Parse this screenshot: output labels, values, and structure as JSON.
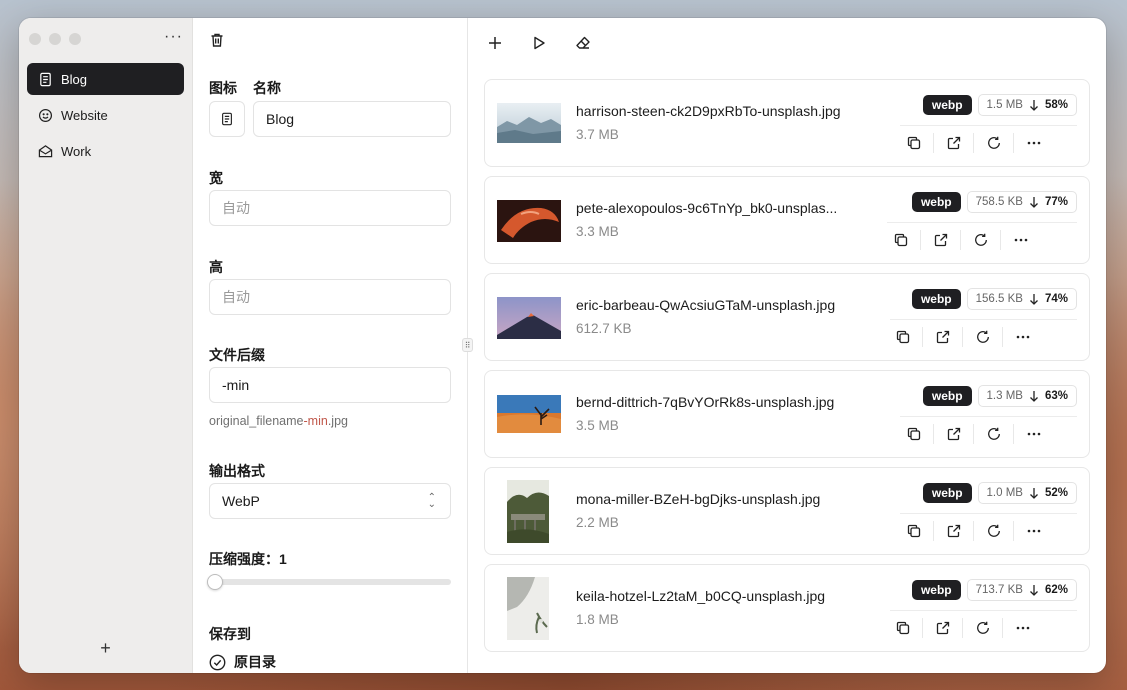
{
  "sidebar": {
    "items": [
      {
        "label": "Blog",
        "icon": "document-icon",
        "active": true
      },
      {
        "label": "Website",
        "icon": "smiley-icon",
        "active": false
      },
      {
        "label": "Work",
        "icon": "envelope-open-icon",
        "active": false
      }
    ],
    "add_label": "+",
    "more_label": "···"
  },
  "settings": {
    "icon_label": "图标",
    "name_label": "名称",
    "name_value": "Blog",
    "width_label": "宽",
    "width_placeholder": "自动",
    "height_label": "高",
    "height_placeholder": "自动",
    "suffix_label": "文件后缀",
    "suffix_value": "-min",
    "suffix_hint_prefix": "original_filename",
    "suffix_hint_accent": "-min",
    "suffix_hint_ext": ".jpg",
    "format_label": "输出格式",
    "format_value": "WebP",
    "compression_label": "压缩强度：1",
    "compression_level": 0,
    "save_to_label": "保存到",
    "save_option": "原目录"
  },
  "files": [
    {
      "name": "harrison-steen-ck2D9pxRbTo-unsplash.jpg",
      "size": "3.7 MB",
      "format": "webp",
      "new_size": "1.5 MB",
      "reduction": "58%"
    },
    {
      "name": "pete-alexopoulos-9c6TnYp_bk0-unsplas...",
      "size": "3.3 MB",
      "format": "webp",
      "new_size": "758.5 KB",
      "reduction": "77%"
    },
    {
      "name": "eric-barbeau-QwAcsiuGTaM-unsplash.jpg",
      "size": "612.7 KB",
      "format": "webp",
      "new_size": "156.5 KB",
      "reduction": "74%"
    },
    {
      "name": "bernd-dittrich-7qBvYOrRk8s-unsplash.jpg",
      "size": "3.5 MB",
      "format": "webp",
      "new_size": "1.3 MB",
      "reduction": "63%"
    },
    {
      "name": "mona-miller-BZeH-bgDjks-unsplash.jpg",
      "size": "2.2 MB",
      "format": "webp",
      "new_size": "1.0 MB",
      "reduction": "52%"
    },
    {
      "name": "keila-hotzel-Lz2taM_b0CQ-unsplash.jpg",
      "size": "1.8 MB",
      "format": "webp",
      "new_size": "713.7 KB",
      "reduction": "62%"
    }
  ],
  "colors": {
    "accent_dark": "#1f1f22",
    "hint_accent": "#c0574a"
  }
}
